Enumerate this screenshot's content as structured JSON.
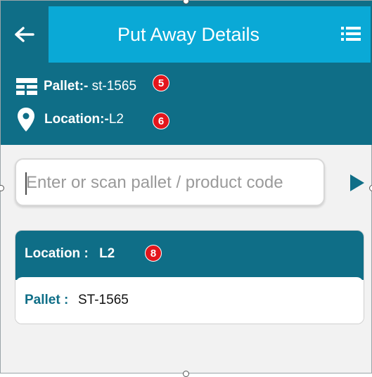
{
  "app": {
    "title": "Put Away Details"
  },
  "info": {
    "pallet_label": "Pallet:-",
    "pallet_value": " st-1565",
    "location_label": "Location:-",
    "location_value": "L2"
  },
  "search": {
    "placeholder": "Enter or scan pallet / product code",
    "value": ""
  },
  "card": {
    "location_label": "Location :",
    "location_value": "L2",
    "pallet_label": "Pallet :",
    "pallet_value": "ST-1565"
  },
  "badges": {
    "b1": "5",
    "b2": "6",
    "b3": "8"
  },
  "colors": {
    "header": "#0f6e87",
    "titlebar": "#0aa9d6",
    "badge": "#e3161c"
  },
  "icons": {
    "back": "arrow-left-icon",
    "menu": "list-menu-icon",
    "pallet": "pallet-icon",
    "location": "map-pin-icon",
    "go": "play-arrow-icon"
  }
}
